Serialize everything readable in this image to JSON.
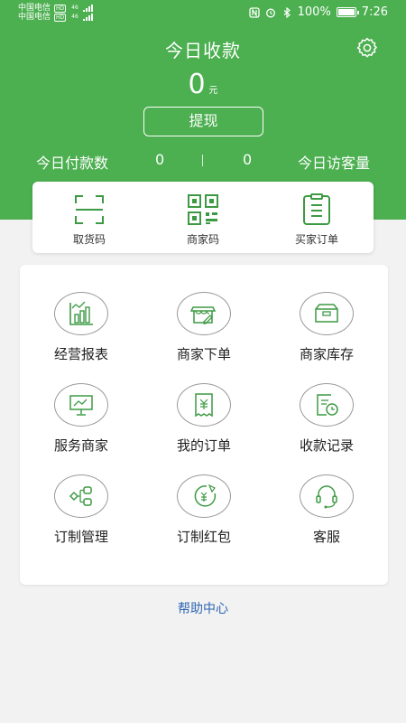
{
  "status_bar": {
    "carriers": [
      {
        "name": "中国电信",
        "hd": "HD",
        "net": "46"
      },
      {
        "name": "中国电信",
        "hd": "HD",
        "net": "46"
      }
    ],
    "battery": "100%",
    "time": "7:26"
  },
  "header": {
    "title": "今日收款",
    "amount": "0",
    "unit": "元",
    "withdraw_label": "提现"
  },
  "stats": {
    "paid_label": "今日付款数",
    "paid_value": "0",
    "visitor_value": "0",
    "visitor_label": "今日访客量"
  },
  "quick_actions": [
    {
      "label": "取货码",
      "icon": "scan-frame-icon"
    },
    {
      "label": "商家码",
      "icon": "qr-code-icon"
    },
    {
      "label": "买家订单",
      "icon": "order-list-icon"
    }
  ],
  "grid": [
    {
      "label": "经营报表",
      "icon": "bar-chart-icon"
    },
    {
      "label": "商家下单",
      "icon": "shop-order-icon"
    },
    {
      "label": "商家库存",
      "icon": "inventory-box-icon"
    },
    {
      "label": "服务商家",
      "icon": "presentation-board-icon"
    },
    {
      "label": "我的订单",
      "icon": "receipt-icon"
    },
    {
      "label": "收款记录",
      "icon": "payment-record-icon"
    },
    {
      "label": "订制管理",
      "icon": "flow-diagram-icon"
    },
    {
      "label": "订制红包",
      "icon": "red-packet-icon"
    },
    {
      "label": "客服",
      "icon": "headset-icon"
    }
  ],
  "help": {
    "label": "帮助中心"
  },
  "colors": {
    "primary": "#4caf50",
    "icon_green": "#3d9a44",
    "link": "#2f66b3"
  }
}
